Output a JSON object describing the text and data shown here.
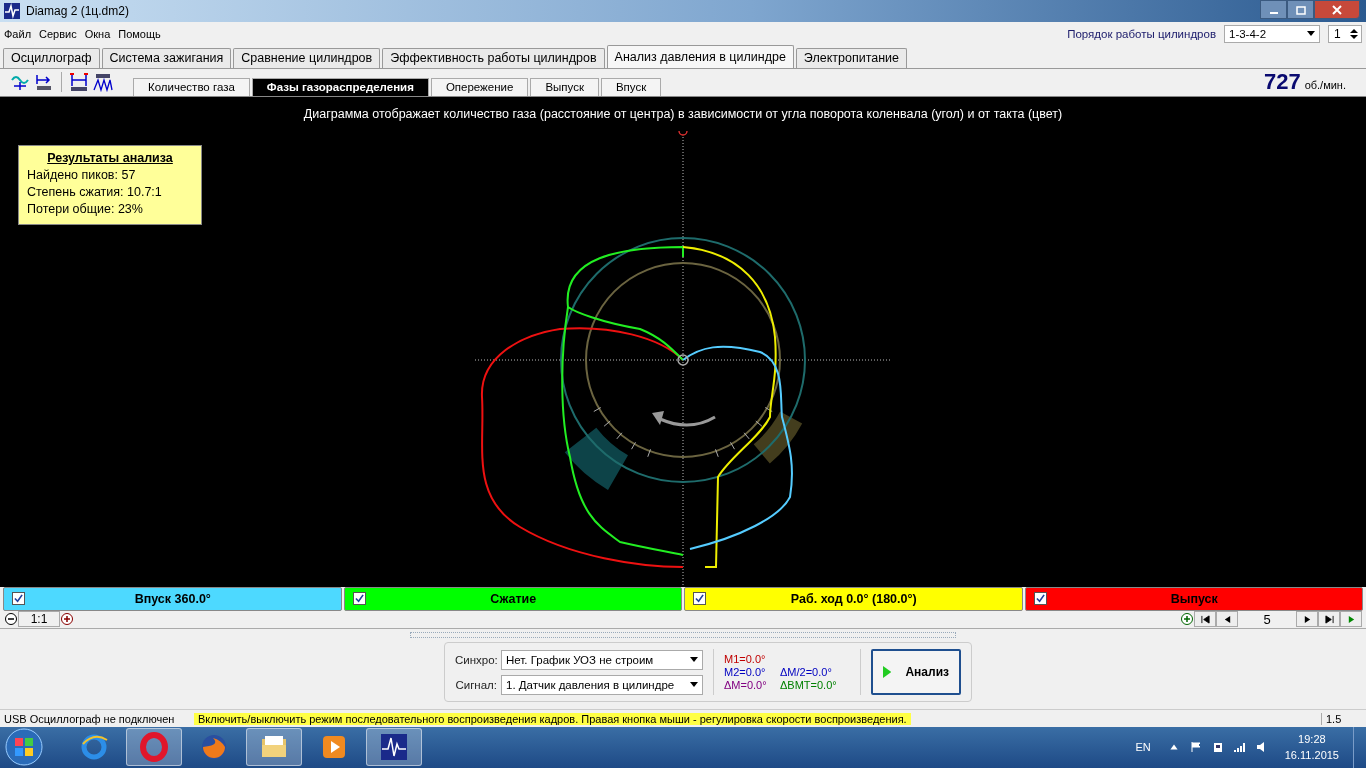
{
  "window": {
    "title": "Diamag 2 (1ц.dm2)"
  },
  "menu": [
    "Файл",
    "Сервис",
    "Окна",
    "Помощь"
  ],
  "cylinder_order": {
    "label": "Порядок работы цилиндров",
    "value": "1-3-4-2",
    "cylinder": "1"
  },
  "tabs": [
    {
      "label": "Осциллограф",
      "selected": false
    },
    {
      "label": "Система зажигания",
      "selected": false
    },
    {
      "label": "Сравнение цилиндров",
      "selected": false
    },
    {
      "label": "Эффективность работы цилиндров",
      "selected": false
    },
    {
      "label": "Анализ давления в цилиндре",
      "selected": true
    },
    {
      "label": "Электропитание",
      "selected": false
    }
  ],
  "subtabs": [
    {
      "label": "Количество газа",
      "selected": false
    },
    {
      "label": "Фазы газораспределения",
      "selected": true
    },
    {
      "label": "Опережение",
      "selected": false
    },
    {
      "label": "Выпуск",
      "selected": false
    },
    {
      "label": "Впуск",
      "selected": false
    }
  ],
  "rpm": {
    "value": "727",
    "unit": "об./мин."
  },
  "diagram": {
    "caption": "Диаграмма отображает количество газа (расстояние от центра) в зависимости от угла поворота коленвала (угол) и от такта (цвет)"
  },
  "results": {
    "title": "Результаты анализа",
    "lines": [
      "Найдено пиков: 57",
      "Степень сжатия: 10.7:1",
      "Потери общие: 23%"
    ]
  },
  "phases": [
    {
      "label": "Впуск 360.0°",
      "checked": true,
      "color": "#4dd9ff"
    },
    {
      "label": "Сжатие",
      "checked": true,
      "color": "#00ff00"
    },
    {
      "label": "Раб. ход 0.0° (180.0°)",
      "checked": true,
      "color": "#ffff00"
    },
    {
      "label": "Выпуск",
      "checked": true,
      "color": "#ff0000"
    }
  ],
  "zoom": "1:1",
  "frame": "5",
  "panel": {
    "sync_label": "Синхро:",
    "sync_value": "Нет. График УОЗ не строим",
    "signal_label": "Сигнал:",
    "signal_value": "1.  Датчик давления в цилиндре",
    "markers": [
      {
        "text": "M1=0.0°",
        "color": "#c00000"
      },
      {
        "text": "M2=0.0°",
        "color": "#0000c0"
      },
      {
        "text": "ΔM/2=0.0°",
        "color": "#0000c0"
      },
      {
        "text": "ΔM=0.0°",
        "color": "#800080"
      },
      {
        "text": "ΔBMT=0.0°",
        "color": "#008000"
      }
    ],
    "analyze": "Анализ"
  },
  "status_bar": [
    "USB Осциллограф не подключен",
    "Включить/выключить режим последовательного воспроизведения кадров. Правая кнопка мыши - регулировка скорости воспроизведения.",
    "1.5"
  ],
  "taskbar": {
    "language": "EN",
    "time": "19:28",
    "date": "16.11.2015"
  }
}
